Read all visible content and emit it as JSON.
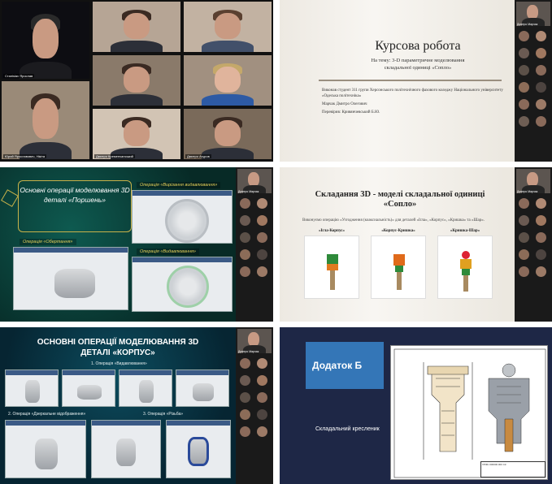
{
  "panel1": {
    "tiles": [
      {
        "name": "Станislav Ярослав"
      },
      {
        "name": ""
      },
      {
        "name": ""
      },
      {
        "name": ""
      },
      {
        "name": "Юрий Ярославович, Нікіта"
      },
      {
        "name": "Шевченко Вік."
      },
      {
        "name": "Дмитро Кременчанський"
      },
      {
        "name": "Юрій-Захар"
      },
      {
        "name": "Дмитро Агуров"
      }
    ]
  },
  "panel2": {
    "title": "Курсова робота",
    "subtitle_line1": "На тему: 3-D параметричне  моделювання",
    "subtitle_line2": "складальної одиниці «Сопло»",
    "author": "Виконав студент 311 групи Херсонського політехнічного фахового коледжу Національного університету «Одеська політехніка»",
    "author_name": "Марчак Дмитро Олегович",
    "checked": "Перевірив: Кривянчевський Б.Ю.",
    "speaker": "Дмитро Марчак"
  },
  "panel3": {
    "title": "Основні операції моделювання 3D деталі «Поршень»",
    "op_rotation": "Операція «Обертання»",
    "op_cut": "Операція «Вирізання видавлювання»",
    "op_extrude": "Операція «Видавлювання»",
    "speaker": "Дмитро Марчак"
  },
  "panel4": {
    "title_line1": "Складання 3D - моделі складальної одиниці",
    "title_line2": "«Сопло»",
    "desc": "Виконуємо операцію «Узгодження (коаксиальність)» для деталей «Ігла», «Корпус», «Кришка» та «Шар».",
    "cap1": "«Ігла-Корпус»",
    "cap2": "«Корпус-Кришка»",
    "cap3": "«Кришка-Шар»",
    "speaker": "Дмитро Марчак"
  },
  "panel5": {
    "title_line1": "ОСНОВНІ ОПЕРАЦІЇ МОДЕЛЮВАННЯ 3D",
    "title_line2": "ДЕТАЛІ «КОРПУС»",
    "op1": "1. Операція «Видавлювання»",
    "op2": "2. Операція «Дзеркальне відображення»",
    "op3": "3. Операція «Різьба»",
    "speaker": "Дмитро Марчак"
  },
  "panel6": {
    "title": "Додаток Б",
    "desc": "Складальний кресленик",
    "stamp": "ХПФК 000000.000 СК"
  },
  "colors": {
    "gold": "#c8b24a",
    "teal": "#0e5a50",
    "blue": "#3476b7"
  }
}
